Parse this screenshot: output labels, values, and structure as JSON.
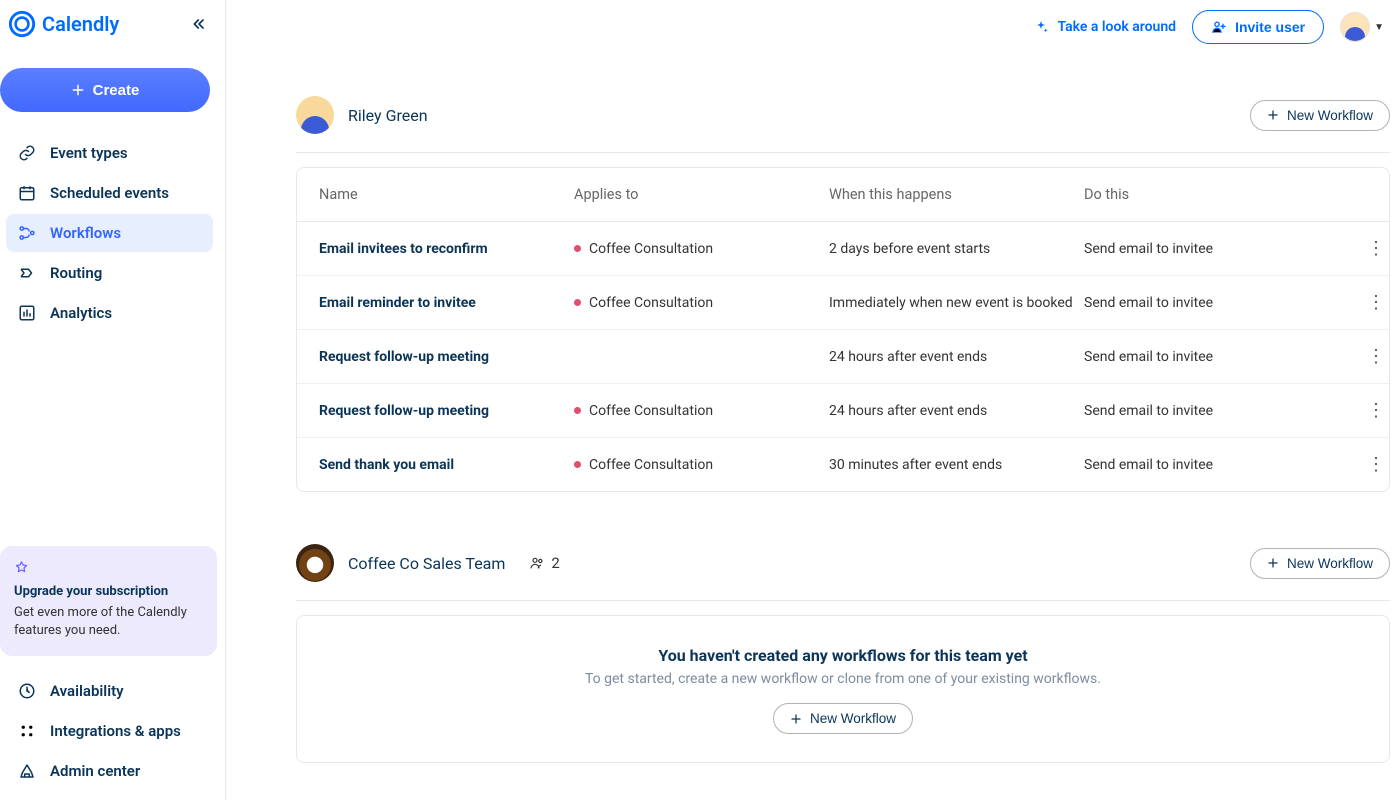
{
  "brand": {
    "name": "Calendly"
  },
  "topbar": {
    "tour_label": "Take a look around",
    "invite_label": "Invite user"
  },
  "sidebar": {
    "create_label": "Create",
    "items": [
      {
        "label": "Event types"
      },
      {
        "label": "Scheduled events"
      },
      {
        "label": "Workflows"
      },
      {
        "label": "Routing"
      },
      {
        "label": "Analytics"
      }
    ],
    "upgrade": {
      "title": "Upgrade your subscription",
      "body": "Get even more of the Calendly features you need."
    },
    "bottom_items": [
      {
        "label": "Availability"
      },
      {
        "label": "Integrations & apps"
      },
      {
        "label": "Admin center"
      }
    ]
  },
  "sections": [
    {
      "owner_name": "Riley Green",
      "new_workflow_label": "New Workflow",
      "columns": {
        "name": "Name",
        "applies_to": "Applies to",
        "when": "When this happens",
        "do": "Do this"
      },
      "rows": [
        {
          "name": "Email invitees to reconfirm",
          "applies_to": "Coffee Consultation",
          "applies_color": "#e04f6e",
          "when": "2 days before event starts",
          "do": "Send email to invitee"
        },
        {
          "name": "Email reminder to invitee",
          "applies_to": "Coffee Consultation",
          "applies_color": "#e04f6e",
          "when": "Immediately when new event is booked",
          "do": "Send email to invitee"
        },
        {
          "name": "Request follow-up meeting",
          "applies_to": "",
          "applies_color": "",
          "when": "24 hours after event ends",
          "do": "Send email to invitee"
        },
        {
          "name": "Request follow-up meeting",
          "applies_to": "Coffee Consultation",
          "applies_color": "#e04f6e",
          "when": "24 hours after event ends",
          "do": "Send email to invitee"
        },
        {
          "name": "Send thank you email",
          "applies_to": "Coffee Consultation",
          "applies_color": "#e04f6e",
          "when": "30 minutes after event ends",
          "do": "Send email to invitee"
        }
      ]
    },
    {
      "owner_name": "Coffee Co Sales Team",
      "member_count": "2",
      "new_workflow_label": "New Workflow",
      "empty_title": "You haven't created any workflows for this team yet",
      "empty_sub": "To get started, create a new workflow or clone from one of your existing workflows.",
      "empty_cta": "New Workflow"
    }
  ]
}
